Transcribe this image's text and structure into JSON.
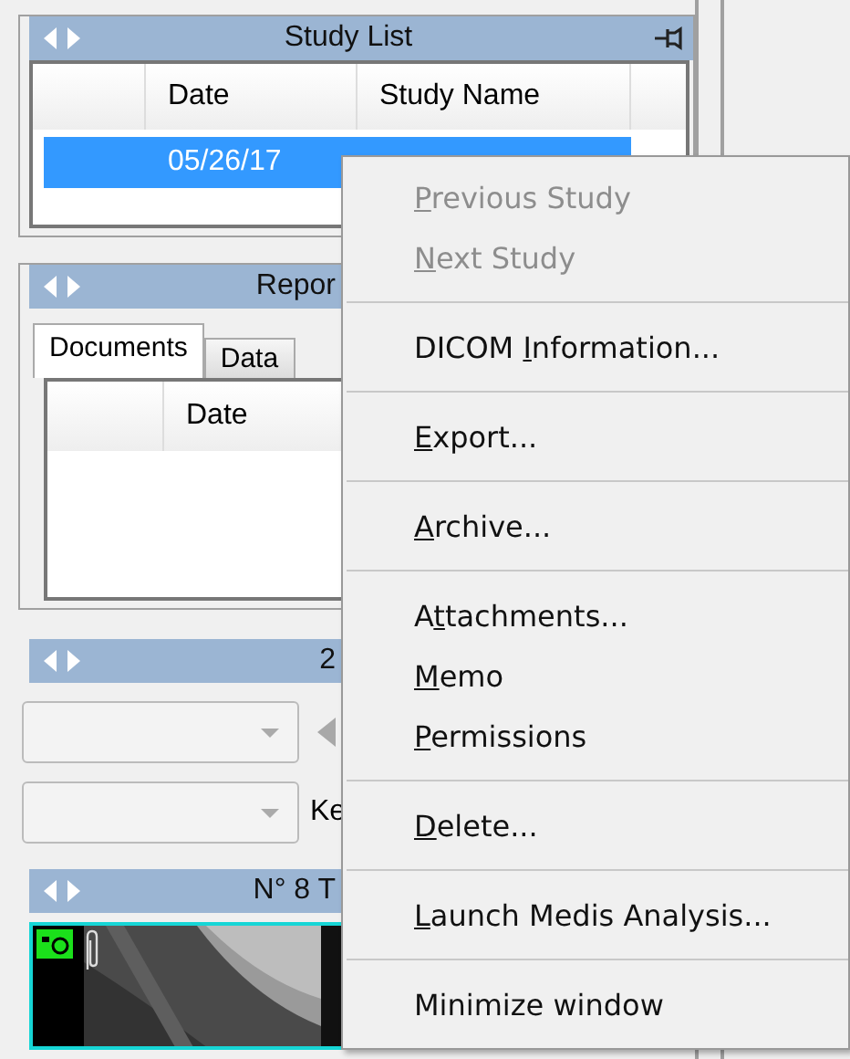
{
  "study_list": {
    "title": "Study List",
    "columns": [
      "Date",
      "Study Name"
    ],
    "rows": [
      {
        "date": "05/26/17",
        "selected": true
      }
    ]
  },
  "reports": {
    "title": "Repor",
    "tabs": [
      {
        "label": "Documents",
        "selected": true
      },
      {
        "label": "Data",
        "selected": false
      }
    ],
    "columns": [
      "Date"
    ]
  },
  "series": {
    "title": "2",
    "key_label": "Ke"
  },
  "thumbnails": {
    "title": "N° 8 T"
  },
  "context_menu": [
    {
      "kind": "item",
      "key": "P",
      "post": "revious Study",
      "disabled": true
    },
    {
      "kind": "item",
      "key": "N",
      "post": "ext Study",
      "disabled": true
    },
    {
      "kind": "separator"
    },
    {
      "kind": "item",
      "pre": "DICOM ",
      "key": "I",
      "post": "nformation...",
      "disabled": false
    },
    {
      "kind": "separator"
    },
    {
      "kind": "item",
      "key": "E",
      "post": "xport...",
      "disabled": false
    },
    {
      "kind": "separator"
    },
    {
      "kind": "item",
      "key": "A",
      "post": "rchive...",
      "disabled": false
    },
    {
      "kind": "separator"
    },
    {
      "kind": "item",
      "pre": "A",
      "key": "t",
      "post": "tachments...",
      "disabled": false
    },
    {
      "kind": "item",
      "key": "M",
      "post": "emo",
      "disabled": false
    },
    {
      "kind": "item",
      "key": "P",
      "post": "ermissions",
      "disabled": false
    },
    {
      "kind": "separator"
    },
    {
      "kind": "item",
      "key": "D",
      "post": "elete...",
      "disabled": false
    },
    {
      "kind": "separator"
    },
    {
      "kind": "item",
      "key": "L",
      "post": "aunch Medis Analysis...",
      "disabled": false
    },
    {
      "kind": "separator"
    },
    {
      "kind": "item",
      "pre": "Minimize window",
      "disabled": false
    }
  ]
}
